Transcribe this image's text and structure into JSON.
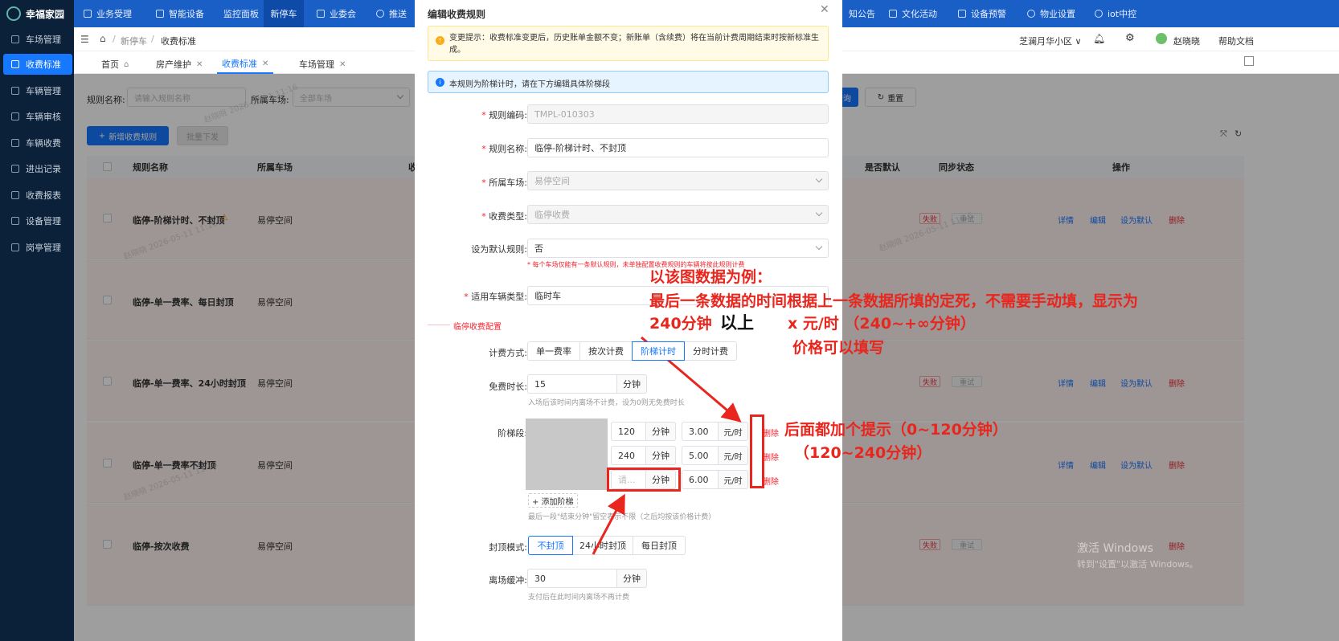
{
  "app": {
    "name": "幸福家园"
  },
  "sidebar": {
    "items": [
      {
        "label": "车场管理"
      },
      {
        "label": "收费标准",
        "active": true
      },
      {
        "label": "车辆管理"
      },
      {
        "label": "车辆审核"
      },
      {
        "label": "车辆收费"
      },
      {
        "label": "进出记录"
      },
      {
        "label": "收费报表"
      },
      {
        "label": "设备管理"
      },
      {
        "label": "岗亭管理"
      }
    ]
  },
  "topnav": {
    "items": [
      {
        "label": "业务受理"
      },
      {
        "label": "智能设备"
      },
      {
        "label": "监控面板"
      },
      {
        "label": "新停车"
      },
      {
        "label": "业委会"
      },
      {
        "label": "推送"
      },
      {
        "label": "知公告"
      },
      {
        "label": "文化活动"
      },
      {
        "label": "设备预警"
      },
      {
        "label": "物业设置"
      },
      {
        "label": "iot中控"
      }
    ]
  },
  "breadcrumb": {
    "level1": "新停车",
    "level2": "收费标准"
  },
  "header_right": {
    "community": "芝澜月华小区",
    "user": "赵晓晓",
    "help": "帮助文档"
  },
  "tabs": [
    {
      "label": "首页"
    },
    {
      "label": "房产维护"
    },
    {
      "label": "收费标准",
      "active": true
    },
    {
      "label": "车场管理"
    }
  ],
  "filters": {
    "rule_name_label": "规则名称:",
    "rule_name_placeholder": "请输入规则名称",
    "lot_label": "所属车场:",
    "lot_placeholder": "全部车场",
    "query_label": "查询",
    "reset_label": "重置"
  },
  "actions": {
    "add_label": "新增收费规则",
    "batch_label": "批量下发"
  },
  "table": {
    "headers": [
      "规则名称",
      "所属车场",
      "收",
      "是否默认",
      "同步状态",
      "操作"
    ],
    "rows": [
      {
        "name": "临停-阶梯计时、不封顶",
        "lot": "易停空间",
        "warn": true,
        "status": "失败",
        "retry": "重试",
        "ops": [
          "详情",
          "编辑",
          "设为默认",
          "删除"
        ]
      },
      {
        "name": "临停-单一费率、每日封顶",
        "lot": "易停空间",
        "warn": false,
        "status": "",
        "retry": "",
        "ops": [
          "",
          "",
          "",
          ""
        ]
      },
      {
        "name": "临停-单一费率、24小时封顶",
        "lot": "易停空间",
        "warn": false,
        "status": "失败",
        "retry": "重试",
        "ops": [
          "详情",
          "编辑",
          "设为默认",
          "删除"
        ]
      },
      {
        "name": "临停-单一费率不封顶",
        "lot": "易停空间",
        "warn": false,
        "status": "",
        "retry": "",
        "ops": [
          "详情",
          "编辑",
          "设为默认",
          "删除"
        ]
      },
      {
        "name": "临停-按次收费",
        "lot": "易停空间",
        "warn": false,
        "status": "失败",
        "retry": "重试",
        "ops": [
          "",
          "",
          "",
          "删除"
        ]
      }
    ]
  },
  "watermark": {
    "text": "赵晓晓 2026-05-11 11:16"
  },
  "windows_watermark": {
    "line1": "激活 Windows",
    "line2": "转到\"设置\"以激活 Windows。"
  },
  "modal": {
    "title": "编辑收费规则",
    "warning": "变更提示：收费标准变更后，历史账单金额不变；新账单（含续费）将在当前计费周期结束时按新标准生成。",
    "info": "本规则为阶梯计时，请在下方编辑具体阶梯段",
    "fields": {
      "code_label": "规则编码:",
      "code_value": "TMPL-010303",
      "name_label": "规则名称:",
      "name_value": "临停-阶梯计时、不封顶",
      "lot_label": "所属车场:",
      "lot_value": "易停空间",
      "type_label": "收费类型:",
      "type_value": "临停收费",
      "default_label": "设为默认规则:",
      "default_value": "否",
      "default_hint": "* 每个车场仅能有一条默认规则，未单独配置收费规则的车辆将按此规则计费",
      "vehicle_label": "适用车辆类型:",
      "vehicle_value": "临时车"
    },
    "section_title": "临停收费配置",
    "billing": {
      "label": "计费方式:",
      "options": [
        "单一费率",
        "按次计费",
        "阶梯计时",
        "分时计费"
      ],
      "selected": "阶梯计时"
    },
    "free": {
      "label": "免费时长:",
      "value": "15",
      "unit": "分钟",
      "hint": "入场后该时间内离场不计费，设为0则无免费时长"
    },
    "tiers": {
      "label": "阶梯段:",
      "rows": [
        {
          "minutes": "120",
          "unit": "分钟",
          "price": "3.00",
          "price_unit": "元/时",
          "del": "删除"
        },
        {
          "minutes": "240",
          "unit": "分钟",
          "price": "5.00",
          "price_unit": "元/时",
          "del": "删除"
        },
        {
          "minutes": "",
          "placeholder": "请...",
          "unit": "分钟",
          "price": "6.00",
          "price_unit": "元/时",
          "del": "删除"
        }
      ],
      "add_label": "+ 添加阶梯",
      "hint": "最后一段\"结束分钟\"留空表示不限（之后均按该价格计费）"
    },
    "cap": {
      "label": "封顶模式:",
      "options": [
        "不封顶",
        "24小时封顶",
        "每日封顶"
      ],
      "selected": "不封顶"
    },
    "buffer": {
      "label": "离场缓冲:",
      "value": "30",
      "unit": "分钟",
      "hint": "支付后在此时间内离场不再计费"
    }
  },
  "annotations": {
    "a1": "以该图数据为例：",
    "a2": "最后一条数据的时间根据上一条数据所填的定死，不需要手动填，显示为",
    "a3a": "240分钟",
    "a3b": "以上",
    "a3c": "x 元/时 （240~+∞分钟）",
    "a4": "价格可以填写",
    "b1": "后面都加个提示（0~120分钟）",
    "b2": "（120~240分钟）",
    "color": "#e8261d"
  }
}
